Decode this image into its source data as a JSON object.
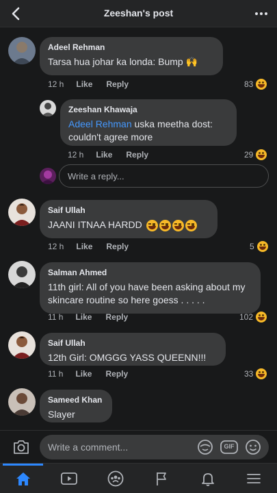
{
  "header": {
    "title": "Zeeshan's post"
  },
  "colors": {
    "background": "#18191a",
    "bubble": "#3a3b3c",
    "accent": "#2d88ff",
    "mention": "#4599ff",
    "muted": "#b0b3b8"
  },
  "actions": {
    "like": "Like",
    "reply": "Reply"
  },
  "comments": [
    {
      "name": "Adeel Rehman",
      "text": "Tarsa hua johar ka londa: Bump 🙌",
      "time": "12 h",
      "reactions": "83"
    },
    {
      "name": "Zeeshan Khawaja",
      "mention": "Adeel Rehman",
      "text": " uska meetha dost: couldn't agree more",
      "time": "12 h",
      "reactions": "29"
    },
    {
      "name": "Saif Ullah",
      "text": "JAANI ITNAA HARDD",
      "time": "12 h",
      "reactions": "5"
    },
    {
      "name": "Salman Ahmed",
      "text": "11th girl: All of you have been asking about my skincare routine so here goess . . . . .",
      "time": "11 h",
      "reactions": "102"
    },
    {
      "name": "Saif Ullah",
      "text": "12th Girl: OMGGG YASS QUEENN!!!",
      "time": "11 h",
      "reactions": "33"
    },
    {
      "name": "Sameed Khan",
      "text": "Slayer",
      "time": "",
      "reactions": ""
    }
  ],
  "reply_box": {
    "placeholder": "Write a reply..."
  },
  "composer": {
    "placeholder": "Write a comment...",
    "gif_label": "GIF"
  },
  "tabs": [
    {
      "icon": "home-icon",
      "active": true
    },
    {
      "icon": "watch-icon",
      "active": false
    },
    {
      "icon": "groups-icon",
      "active": false
    },
    {
      "icon": "pages-flag-icon",
      "active": false
    },
    {
      "icon": "notifications-bell-icon",
      "active": false
    },
    {
      "icon": "menu-icon",
      "active": false
    }
  ]
}
